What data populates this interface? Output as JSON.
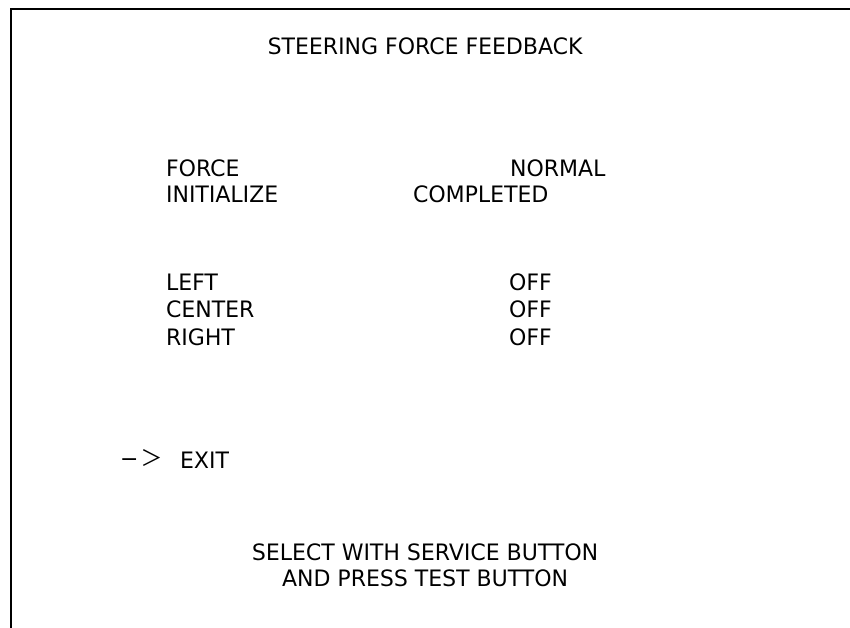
{
  "screen": {
    "title": "STEERING FORCE FEEDBACK",
    "settings": [
      {
        "label": "FORCE",
        "value": "NORMAL"
      },
      {
        "label": "INITIALIZE",
        "value": "COMPLETED"
      }
    ],
    "switches": [
      {
        "label": "LEFT",
        "value": "OFF"
      },
      {
        "label": "CENTER",
        "value": "OFF"
      },
      {
        "label": "RIGHT",
        "value": "OFF"
      }
    ],
    "cursor": "−＞",
    "menu": {
      "exit_label": "EXIT"
    },
    "instructions": {
      "line1": "SELECT WITH SERVICE BUTTON",
      "line2": "AND PRESS TEST BUTTON"
    }
  }
}
